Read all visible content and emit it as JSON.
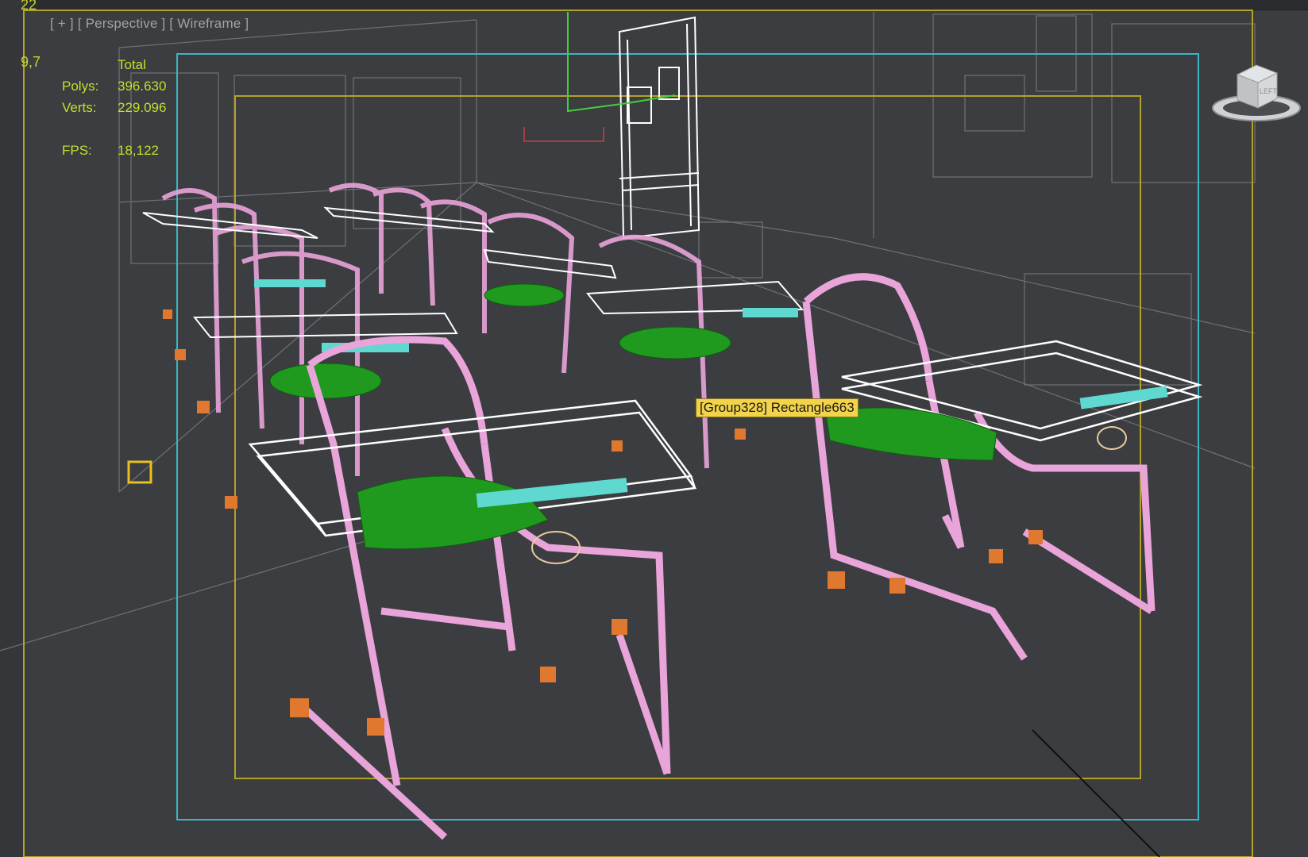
{
  "viewport": {
    "labels": [
      "[ + ]",
      "[ Perspective ]",
      "[ Wireframe ]"
    ],
    "edge_numbers": [
      "22",
      "9,7"
    ]
  },
  "stats": {
    "header": "Total",
    "rows": [
      {
        "label": "Polys:",
        "value": "396.630"
      },
      {
        "label": "Verts:",
        "value": "229.096"
      }
    ],
    "fps_label": "FPS:",
    "fps_value": "18,122"
  },
  "tooltip": "[Group328] Rectangle663",
  "viewcube": {
    "face_label": "LEFT"
  },
  "colors": {
    "background": "#3b3d40",
    "chair_frame": "#e9a4d9",
    "seat": "#1f9a1f",
    "desk": "#ffffff",
    "accent_cyan": "#5fd8d0",
    "feet": "#e07830",
    "safe_frame_cyan": "#3ab6c4",
    "safe_frame_yellow": "#b3a227"
  }
}
